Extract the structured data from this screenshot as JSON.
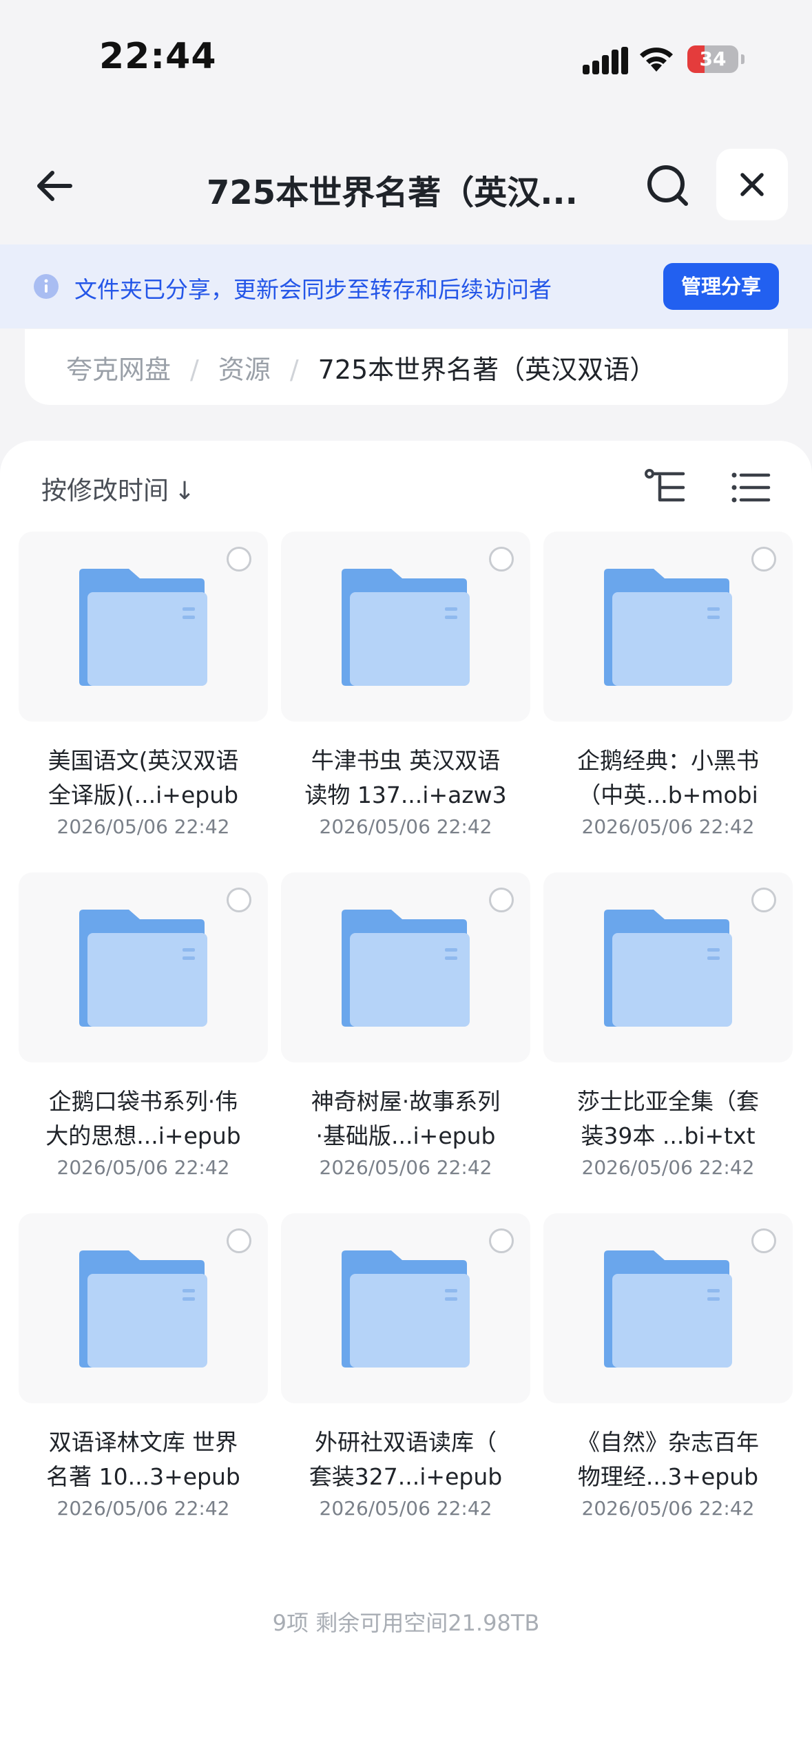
{
  "status_bar": {
    "time": "22:44",
    "battery_text": "34",
    "battery_level": 0.34,
    "battery_color": "#e43c3c"
  },
  "header": {
    "title": "725本世界名著（英汉...",
    "back_icon": "arrow-left-icon",
    "search_icon": "search-icon",
    "close_icon": "close-icon"
  },
  "share_banner": {
    "text": "文件夹已分享，更新会同步至转存和后续访问者",
    "button_label": "管理分享",
    "accent": "#2260f0"
  },
  "breadcrumb": {
    "items": [
      "夸克网盘",
      "资源"
    ],
    "separator": "/",
    "current": "725本世界名著（英汉双语）"
  },
  "toolbar": {
    "sort_label": "按修改时间",
    "sort_arrow": "↓"
  },
  "files": [
    {
      "line1": "美国语文(英汉双语",
      "line2": "全译版)(...i+epub",
      "date": "2026/05/06 22:42"
    },
    {
      "line1": "牛津书虫 英汉双语",
      "line2": "读物 137...i+azw3",
      "date": "2026/05/06 22:42"
    },
    {
      "line1": "企鹅经典：小黑书",
      "line2": "（中英...b+mobi",
      "date": "2026/05/06 22:42"
    },
    {
      "line1": "企鹅口袋书系列·伟",
      "line2": "大的思想...i+epub",
      "date": "2026/05/06 22:42"
    },
    {
      "line1": "神奇树屋·故事系列",
      "line2": "·基础版...i+epub",
      "date": "2026/05/06 22:42"
    },
    {
      "line1": "莎士比亚全集（套",
      "line2": "装39本 ...bi+txt",
      "date": "2026/05/06 22:42"
    },
    {
      "line1": "双语译林文库 世界",
      "line2": "名著 10...3+epub",
      "date": "2026/05/06 22:42"
    },
    {
      "line1": "外研社双语读库（",
      "line2": "套装327...i+epub",
      "date": "2026/05/06 22:42"
    },
    {
      "line1": "《自然》杂志百年",
      "line2": "物理经...3+epub",
      "date": "2026/05/06 22:42"
    }
  ],
  "footer": {
    "info": "9项 剩余可用空间21.98TB"
  }
}
